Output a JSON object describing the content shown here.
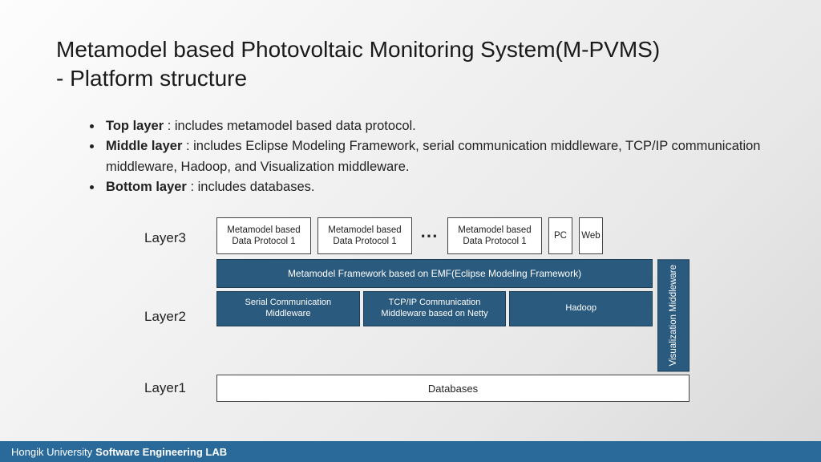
{
  "title_line1": "Metamodel based Photovoltaic Monitoring System(M-PVMS)",
  "title_line2": "- Platform structure",
  "bullets": {
    "top_label": "Top layer",
    "top_text": " : includes metamodel based data protocol.",
    "mid_label": "Middle layer",
    "mid_text": " : includes Eclipse Modeling Framework, serial communication middleware, TCP/IP communication middleware, Hadoop, and Visualization middleware.",
    "bot_label": "Bottom layer",
    "bot_text": " : includes databases."
  },
  "labels": {
    "layer3": "Layer3",
    "layer2": "Layer2",
    "layer1": "Layer1"
  },
  "layer3": {
    "proto1": "Metamodel based Data Protocol 1",
    "proto2": "Metamodel based Data Protocol 1",
    "dots": "⋯",
    "proto3": "Metamodel based Data Protocol 1",
    "pc": "PC",
    "web": "Web"
  },
  "layer2": {
    "emf": "Metamodel Framework based on EMF(Eclipse Modeling Framework)",
    "serial": "Serial Communication Middleware",
    "tcpip": "TCP/IP Communication Middleware based on Netty",
    "hadoop": "Hadoop",
    "viz": "Visualization Middleware"
  },
  "layer1": {
    "db": "Databases"
  },
  "footer": {
    "org": "Hongik University",
    "lab": "Software Engineering LAB"
  },
  "colors": {
    "box_dark": "#2a5a7d",
    "footer": "#2a6a9a"
  }
}
